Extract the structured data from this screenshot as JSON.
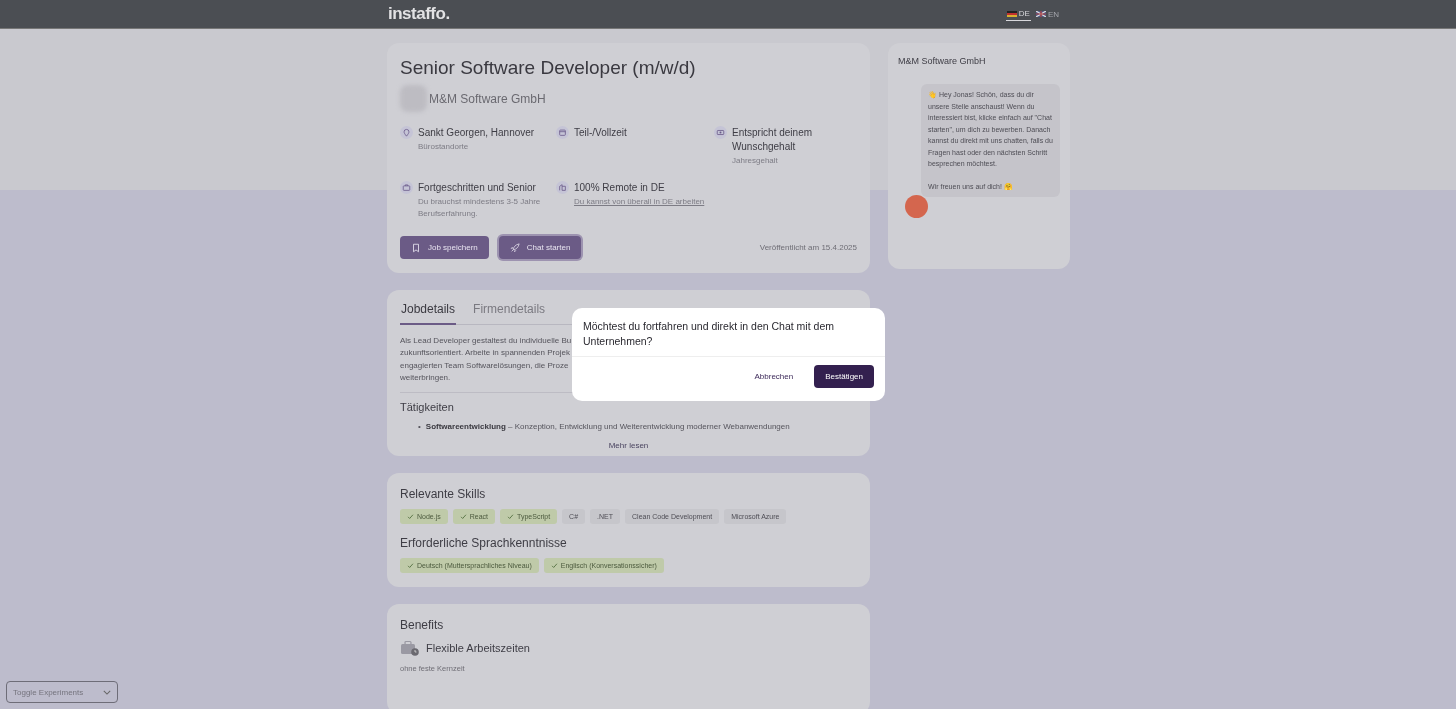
{
  "header": {
    "logo": "instaffo.",
    "languages": [
      {
        "code": "DE",
        "selected": true
      },
      {
        "code": "EN",
        "selected": false
      }
    ]
  },
  "job": {
    "title": "Senior Software Developer (m/w/d)",
    "company": "M&M Software GmbH",
    "facts": [
      {
        "label": "Sankt Georgen, Hannover",
        "sub": "Bürostandorte",
        "link": false
      },
      {
        "label": "Teil-/Vollzeit",
        "link": false
      },
      {
        "label": "Entspricht deinem Wunschgehalt",
        "sub": "Jahresgehalt",
        "link": false
      },
      {
        "label": "Fortgeschritten und Senior",
        "sub": "Du brauchst mindestens 3-5 Jahre Berufserfahrung.",
        "link": false
      },
      {
        "label": "100% Remote in DE",
        "sub": "Du kannst von überall in DE arbeiten",
        "link": true
      }
    ],
    "buttons": [
      {
        "label": "Job speichern",
        "focused": false
      },
      {
        "label": "Chat starten",
        "focused": true
      }
    ],
    "published": "Veröffentlicht am 15.4.2025"
  },
  "details": {
    "tabs": [
      {
        "label": "Jobdetails",
        "selected": true
      },
      {
        "label": "Firmendetails",
        "selected": false
      }
    ],
    "description_lines": [
      "Als Lead Developer gestaltest du individuelle Bu",
      "zukunftsorientiert. Arbeite in spannenden Projek",
      "engagierten Team Softwarelösungen, die Proze",
      "weiterbringen."
    ],
    "section_title": "Tätigkeiten",
    "bullets": [
      {
        "marker": "•",
        "bold": "Softwareentwicklung",
        "text": " – Konzeption, Entwicklung und Weiterentwicklung moderner Webanwendungen"
      }
    ],
    "more": "Mehr lesen"
  },
  "skills": {
    "title": "Relevante Skills",
    "items": [
      {
        "label": "Node.js",
        "matched": true
      },
      {
        "label": "React",
        "matched": true
      },
      {
        "label": "TypeScript",
        "matched": true
      },
      {
        "label": "C#",
        "matched": false
      },
      {
        "label": ".NET",
        "matched": false
      },
      {
        "label": "Clean Code Development",
        "matched": false
      },
      {
        "label": "Microsoft Azure",
        "matched": false
      }
    ],
    "languages_title": "Erforderliche Sprachkenntnisse",
    "languages": [
      {
        "label": "Deutsch (Muttersprachliches Niveau)",
        "matched": true
      },
      {
        "label": "Englisch (Konversationssicher)",
        "matched": true
      }
    ]
  },
  "benefits": {
    "title": "Benefits",
    "items": [
      {
        "title": "Flexible Arbeitszeiten",
        "sub": "ohne feste Kernzeit"
      }
    ]
  },
  "chat": {
    "company": "M&M Software GmbH",
    "message": "👋 Hey Jonas! Schön, dass du dir unsere Stelle anschaust! Wenn du interessiert bist, klicke einfach auf \"Chat starten\", um dich zu bewerben. Danach kannst du direkt mit uns chatten, falls du Fragen hast oder den nächsten Schritt besprechen möchtest.",
    "closing": "Wir freuen uns auf dich! 🤗"
  },
  "dialog": {
    "message": "Möchtest du fortfahren und direkt in den Chat mit dem Unternehmen?",
    "cancel": "Abbrechen",
    "confirm": "Bestätigen"
  },
  "experiments": {
    "label": "Toggle Experiments"
  }
}
